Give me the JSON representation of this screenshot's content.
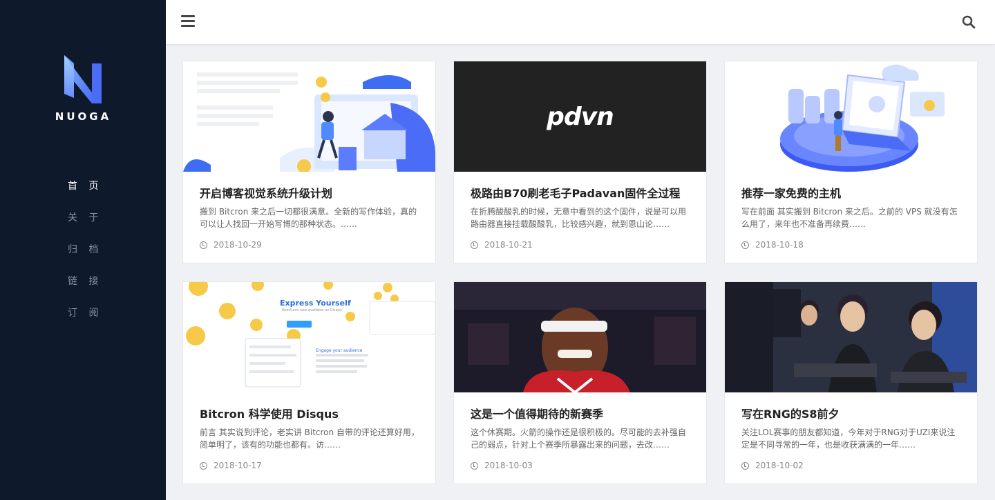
{
  "brand": {
    "name": "NUOGA"
  },
  "nav": {
    "items": [
      {
        "label": "首 页"
      },
      {
        "label": "关 于"
      },
      {
        "label": "归 档"
      },
      {
        "label": "链 接"
      },
      {
        "label": "订 阅"
      }
    ]
  },
  "topbar": {
    "menu_icon": "hamburger-menu-icon",
    "search_icon": "search-icon"
  },
  "posts": [
    {
      "title": "开启博客视觉系统升级计划",
      "excerpt": "搬到 Bitcron 来之后一切都很满意。全新的写作体验，真的可以让人找回一开始写博的那种状态。……",
      "date": "2018-10-29"
    },
    {
      "title": "极路由B70刷老毛子Padavan固件全过程",
      "excerpt": "在折腾酸酸乳的时候，无意中看到的这个固件，说是可以用路由器直接挂载酸酸乳，比较感兴趣，就到恩山论……",
      "date": "2018-10-21",
      "thumb_text": "pdvn"
    },
    {
      "title": "推荐一家免费的主机",
      "excerpt": "写在前面 其实搬到 Bitcron 来之后。之前的 VPS 就没有怎么用了，来年也不准备再续费……",
      "date": "2018-10-18"
    },
    {
      "title": "Bitcron 科学使用 Disqus",
      "excerpt": "前言 其实说到评论，老实讲 Bitcron 自带的评论还算好用，简单明了，该有的功能也都有。访……",
      "date": "2018-10-17",
      "thumb_heading": "Express Yourself",
      "thumb_sub": "Reactions now available on Disqus",
      "thumb_heading2": "Engage your audience"
    },
    {
      "title": "这是一个值得期待的新赛季",
      "excerpt": "这个休赛期。火箭的操作还是很积极的。尽可能的去补强自己的弱点，针对上个赛季所暴露出来的问题，去改……",
      "date": "2018-10-03"
    },
    {
      "title": "写在RNG的S8前夕",
      "excerpt": "关注LOL赛事的朋友都知道，今年对于RNG对于UZI来说注定是不同寻常的一年，也是收获满满的一年……",
      "date": "2018-10-02"
    }
  ]
}
